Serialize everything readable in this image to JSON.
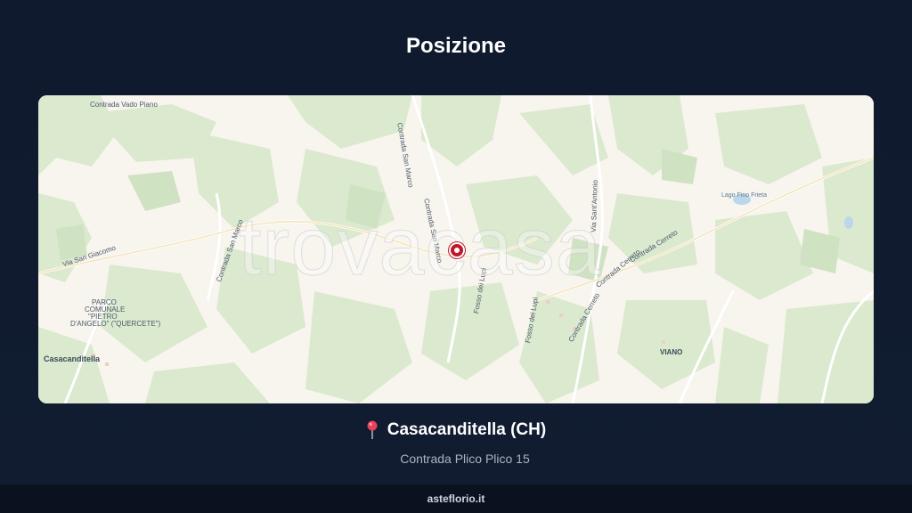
{
  "page": {
    "title": "Posizione"
  },
  "map": {
    "watermark": "trovacasa",
    "labels": {
      "contrada_vado_piano": "Contrada Vado Piano",
      "contrada_san_marco_1": "Contrada San Marco",
      "contrada_san_marco_2": "Contrada San Marco",
      "via_san_giacomo": "Via San Giacomo",
      "contrada_san_marco_3": "Contrada San Marco",
      "parco": "PARCO",
      "comunale": "COMUNALE",
      "pietro": "\"PIETRO",
      "dangelo": "D'ANGELO\" (\"QUERCETE\")",
      "casacanditella": "Casacanditella",
      "fosso_dei_lupi_1": "Fosso dei Lupi",
      "fosso_dei_lupi_2": "Fosso dei Lupi",
      "via_santantonio": "Via Sant'Antonio",
      "contrada_cerreto_1": "Contrada Cerreto",
      "contrada_cerreto_2": "Contrada Cerreto",
      "contrada_cerreto_3": "Contrada Cerreto",
      "lago_fiano": "Lago Fino Frieta",
      "viano": "VIANO"
    }
  },
  "location": {
    "city": "Casacanditella (CH)",
    "address": "Contrada Plico Plico 15",
    "pin_icon_color": "#e8425a"
  },
  "footer": {
    "site": "asteflorio.it"
  },
  "colors": {
    "background": "#0f1a2e",
    "pin": "#c0182b",
    "map_green": "#dbe9d0",
    "map_base": "#f8f5ee"
  }
}
